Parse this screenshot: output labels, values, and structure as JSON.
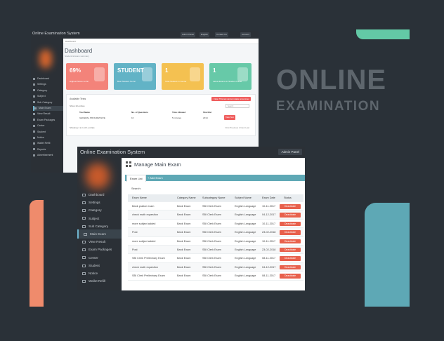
{
  "hero": {
    "line1": "ONLINE",
    "line2": "EXAMINATION"
  },
  "colors": {
    "green": "#63c9a6",
    "teal": "#5ea8b5",
    "coral": "#ef8b6c",
    "danger": "#e8604c"
  },
  "back": {
    "title": "Online Examination System",
    "top_buttons": [
      "Admin Panel",
      "English",
      "Contact Us",
      "Account"
    ],
    "breadcrumb": "Dashboard",
    "heading": "Dashboard",
    "subheading": "Student & Exam summary",
    "sidebar": [
      "Dashboard",
      "Settings",
      "Category",
      "Subject",
      "Sub Category",
      "Main Exam",
      "View Result",
      "Exam Packages",
      "Center",
      "Student",
      "Notice",
      "Wallet Refill",
      "Reports",
      "Advertisement"
    ],
    "cards": [
      {
        "value": "69%",
        "label": "Highest Score so far"
      },
      {
        "value": "STUDENT",
        "label": "Best Student So far"
      },
      {
        "value": "1",
        "label": "Total Student in Center"
      },
      {
        "value": "1",
        "label": "Latest Exams in Student Panel"
      }
    ],
    "table": {
      "title": "Available Tests",
      "alert": "Note: This test cannot retake once done",
      "show_label": "Show 10 entries",
      "search": "Search:",
      "headers": [
        "Test Name",
        "No. of Questions",
        "Time Allowed",
        "Shortlist"
      ],
      "row": [
        "GENERAL PROGRESSIVE",
        "10",
        "5 minutes",
        "2014"
      ],
      "action": "Take Test",
      "footer": "Showing 1 to 1 of 1 entries",
      "pager": "First  Previous  1  Next  Last"
    }
  },
  "front": {
    "title": "Online Examination System",
    "admin": "Admin Panel",
    "heading": "Manage Main Exam",
    "tabs": {
      "list": "Exam List",
      "add": "+ Add Exam"
    },
    "search_label": "Search:",
    "sidebar": [
      "Dashboard",
      "Settings",
      "Category",
      "Subject",
      "Sub Category",
      "Main Exam",
      "View Result",
      "Exam Packages",
      "Center",
      "Student",
      "Notice",
      "Wallet Refill"
    ],
    "columns": [
      "Exam Name",
      "Category Name",
      "Subcategory Name",
      "Subject Name",
      "Exam Date",
      "Status"
    ],
    "action_label": "Deactivate",
    "rows": [
      [
        "Bank pratice exam",
        "Bank Exam",
        "SBI Clerk Exam",
        "English Language",
        "10-11-2017"
      ],
      [
        "check math equestion",
        "Bank Exam",
        "SBI Clerk Exam",
        "English Language",
        "04-12-2017"
      ],
      [
        "more subject added",
        "Bank Exam",
        "SBI Clerk Exam",
        "English Language",
        "10-11-2017"
      ],
      [
        "Post",
        "Bank Exam",
        "SBI Clerk Exam",
        "English Language",
        "23-02-2018"
      ],
      [
        "more subject added",
        "Bank Exam",
        "SBI Clerk Exam",
        "English Language",
        "10-11-2017"
      ],
      [
        "Post",
        "Bank Exam",
        "SBI Clerk Exam",
        "English Language",
        "23-02-2018"
      ],
      [
        "SBI Clerk Preliminary Exam",
        "Bank Exam",
        "SBI Clerk Exam",
        "English Language",
        "08-11-2017"
      ],
      [
        "check math equestion",
        "Bank Exam",
        "SBI Clerk Exam",
        "English Language",
        "04-12-2017"
      ],
      [
        "SBI Clerk Preliminary Exam",
        "Bank Exam",
        "SBI Clerk Exam",
        "English Language",
        "08-11-2017"
      ]
    ]
  }
}
